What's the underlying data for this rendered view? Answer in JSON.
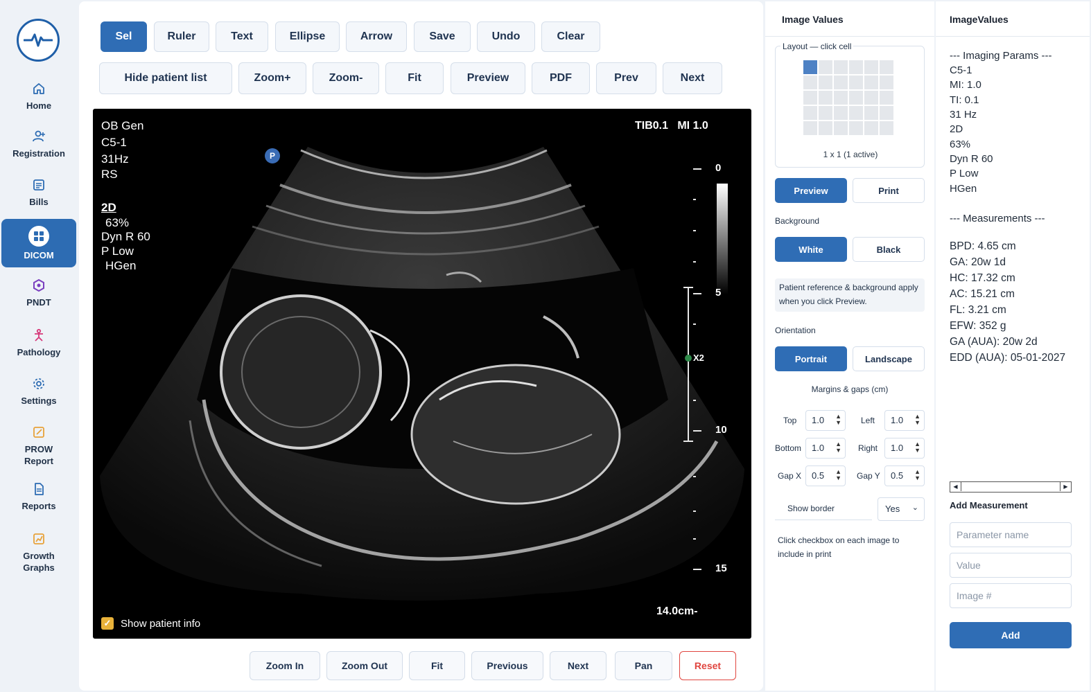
{
  "colors": {
    "accent": "#2f6db5",
    "reset": "#e0453f",
    "checkbox": "#e9b23a"
  },
  "sidebar": {
    "items": [
      {
        "label": "Home",
        "icon": "home-icon"
      },
      {
        "label": "Registration",
        "icon": "user-plus-icon"
      },
      {
        "label": "Bills",
        "icon": "bill-icon"
      },
      {
        "label": "DICOM",
        "icon": "grid-icon",
        "active": true
      },
      {
        "label": "PNDT",
        "icon": "hexagon-icon"
      },
      {
        "label": "Pathology",
        "icon": "pathology-icon"
      },
      {
        "label": "Settings",
        "icon": "gear-icon"
      },
      {
        "label": "PROW\nReport",
        "icon": "edit-icon"
      },
      {
        "label": "Reports",
        "icon": "document-icon"
      },
      {
        "label": "Growth\nGraphs",
        "icon": "chart-icon"
      }
    ]
  },
  "toolbar": {
    "row1": [
      "Sel",
      "Ruler",
      "Text",
      "Ellipse",
      "Arrow",
      "Save",
      "Undo",
      "Clear"
    ],
    "row2": [
      "Hide patient list",
      "Zoom+",
      "Zoom-",
      "Fit",
      "Preview",
      "PDF",
      "Prev",
      "Next"
    ]
  },
  "viewer": {
    "overlay_left": [
      "OB Gen",
      "C5-1",
      "31Hz",
      "RS"
    ],
    "mode": "2D",
    "overlay_left2": [
      "63%",
      "Dyn R 60",
      "P Low",
      "HGen"
    ],
    "overlay_right": "TIB0.1   MI 1.0",
    "p_badge": "P",
    "scale": [
      "0",
      "5",
      "10",
      "15"
    ],
    "focus_label": "X2",
    "depth": "14.0cm",
    "show_patient_info": "Show patient info"
  },
  "bottom_buttons": [
    "Zoom In",
    "Zoom Out",
    "Fit",
    "Previous",
    "Next",
    "Pan",
    "Reset"
  ],
  "image_values": {
    "title": "Image Values",
    "layout_label": "Layout — click cell",
    "layout_caption": "1 x 1 (1 active)",
    "preview": "Preview",
    "print": "Print",
    "background_label": "Background",
    "white": "White",
    "black": "Black",
    "note": "Patient reference & background apply when you click Preview.",
    "orientation_label": "Orientation",
    "portrait": "Portrait",
    "landscape": "Landscape",
    "margins_label": "Margins & gaps (cm)",
    "top_label": "Top",
    "top_value": "1.0",
    "left_label": "Left",
    "left_value": "1.0",
    "bottom_label": "Bottom",
    "bottom_value": "1.0",
    "right_label": "Right",
    "right_value": "1.0",
    "gapx_label": "Gap X",
    "gapx_value": "0.5",
    "gapy_label": "Gap Y",
    "gapy_value": "0.5",
    "show_border_label": "Show border",
    "show_border_value": "Yes",
    "checkbox_note": "Click checkbox on each image to include in print"
  },
  "right_panel": {
    "title": "ImageValues",
    "params_header": "--- Imaging Params ---",
    "params": [
      "C5-1",
      "MI: 1.0",
      "TI: 0.1",
      "31 Hz",
      "2D",
      "63%",
      "Dyn R 60",
      "P Low",
      "HGen"
    ],
    "measurements_header": "--- Measurements ---",
    "measurements": [
      "BPD: 4.65 cm",
      "GA: 20w 1d",
      "HC: 17.32 cm",
      "AC: 15.21 cm",
      "FL: 3.21 cm",
      "EFW: 352 g",
      "GA (AUA): 20w 2d",
      "EDD (AUA): 05-01-2027"
    ],
    "add_measurement_title": "Add Measurement",
    "param_placeholder": "Parameter name",
    "value_placeholder": "Value",
    "image_placeholder": "Image #",
    "add_button": "Add"
  }
}
